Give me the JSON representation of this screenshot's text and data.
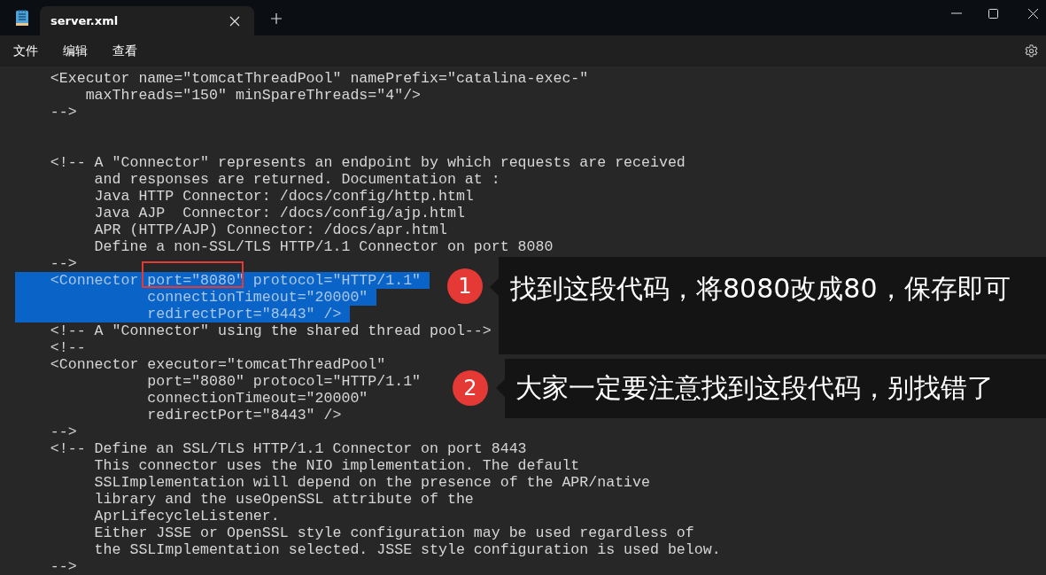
{
  "window": {
    "tabs": [
      {
        "title": "server.xml",
        "selected": true
      }
    ],
    "menu": [
      "文件",
      "编辑",
      "查看"
    ]
  },
  "editor": {
    "blocks": [
      {
        "lines": [
          {
            "text": "    <Executor name=\"tomcatThreadPool\" namePrefix=\"catalina-exec-\"",
            "selected": false
          },
          {
            "text": "        maxThreads=\"150\" minSpareThreads=\"4\"/>",
            "selected": false
          },
          {
            "text": "    -->",
            "selected": false
          }
        ]
      },
      {
        "lines": [
          {
            "text": "    <!-- A \"Connector\" represents an endpoint by which requests are received",
            "selected": false
          },
          {
            "text": "         and responses are returned. Documentation at :",
            "selected": false
          },
          {
            "text": "         Java HTTP Connector: /docs/config/http.html",
            "selected": false
          },
          {
            "text": "         Java AJP  Connector: /docs/config/ajp.html",
            "selected": false
          },
          {
            "text": "         APR (HTTP/AJP) Connector: /docs/apr.html",
            "selected": false
          },
          {
            "text": "         Define a non-SSL/TLS HTTP/1.1 Connector on port 8080",
            "selected": false
          },
          {
            "text": "    -->",
            "selected": false
          },
          {
            "text": "    <Connector port=\"8080\" protocol=\"HTTP/1.1\"",
            "selected": true
          },
          {
            "text": "               connectionTimeout=\"20000\"",
            "selected": true
          },
          {
            "text": "               redirectPort=\"8443\" />",
            "selected": true
          },
          {
            "text": "    <!-- A \"Connector\" using the shared thread pool-->",
            "selected": false
          },
          {
            "text": "    <!--",
            "selected": false
          },
          {
            "text": "    <Connector executor=\"tomcatThreadPool\"",
            "selected": false
          },
          {
            "text": "               port=\"8080\" protocol=\"HTTP/1.1\"",
            "selected": false
          },
          {
            "text": "               connectionTimeout=\"20000\"",
            "selected": false
          },
          {
            "text": "               redirectPort=\"8443\" />",
            "selected": false
          },
          {
            "text": "    -->",
            "selected": false
          },
          {
            "text": "    <!-- Define an SSL/TLS HTTP/1.1 Connector on port 8443",
            "selected": false
          },
          {
            "text": "         This connector uses the NIO implementation. The default",
            "selected": false
          },
          {
            "text": "         SSLImplementation will depend on the presence of the APR/native",
            "selected": false
          },
          {
            "text": "         library and the useOpenSSL attribute of the",
            "selected": false
          },
          {
            "text": "         AprLifecycleListener.",
            "selected": false
          },
          {
            "text": "         Either JSSE or OpenSSL style configuration may be used regardless of",
            "selected": false
          },
          {
            "text": "         the SSLImplementation selected. JSSE style configuration is used below.",
            "selected": false
          },
          {
            "text": "    -->",
            "selected": false
          }
        ]
      }
    ]
  },
  "annotations": [
    {
      "number": "1",
      "text": "找到这段代码，将8080改成80，保存即可"
    },
    {
      "number": "2",
      "text": "大家一定要注意找到这段代码，别找错了"
    }
  ]
}
